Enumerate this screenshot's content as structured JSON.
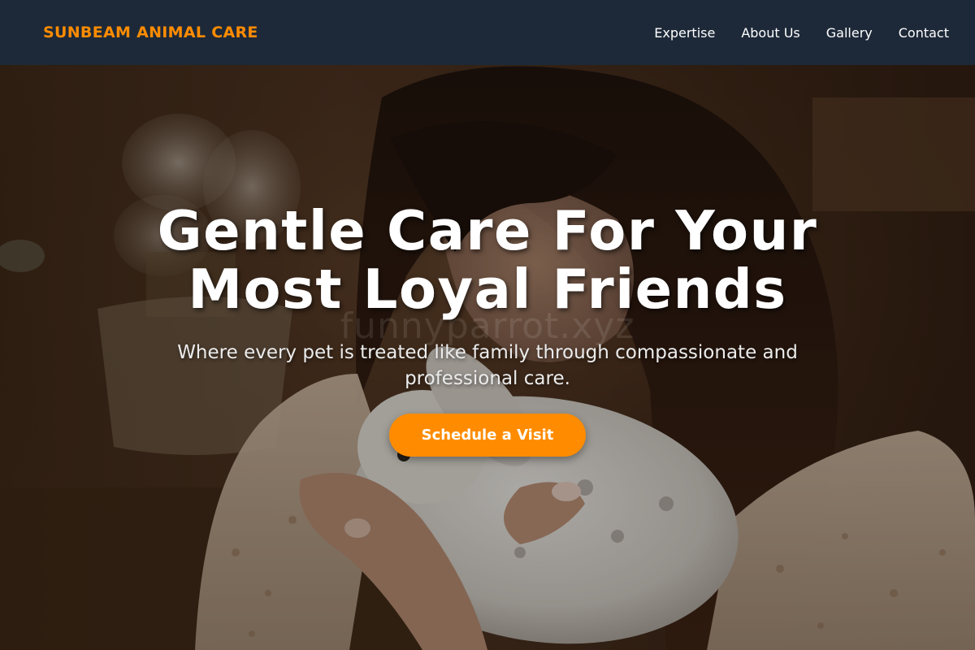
{
  "navbar": {
    "brand": "SUNBEAM ANIMAL CARE",
    "links": [
      {
        "label": "Expertise"
      },
      {
        "label": "About Us"
      },
      {
        "label": "Gallery"
      },
      {
        "label": "Contact"
      }
    ]
  },
  "hero": {
    "title_line1": "Gentle Care For Your",
    "title_line2": "Most Loyal Friends",
    "subtitle": "Where every pet is treated like family through compassionate and professional care.",
    "cta_label": "Schedule a Visit",
    "watermark": "funnyparrot.xyz",
    "image_subject": "woman-holding-white-rabbit"
  },
  "colors": {
    "accent": "#ff8c00",
    "navbar_bg": "#1d2939",
    "text_light": "#ffffff"
  }
}
